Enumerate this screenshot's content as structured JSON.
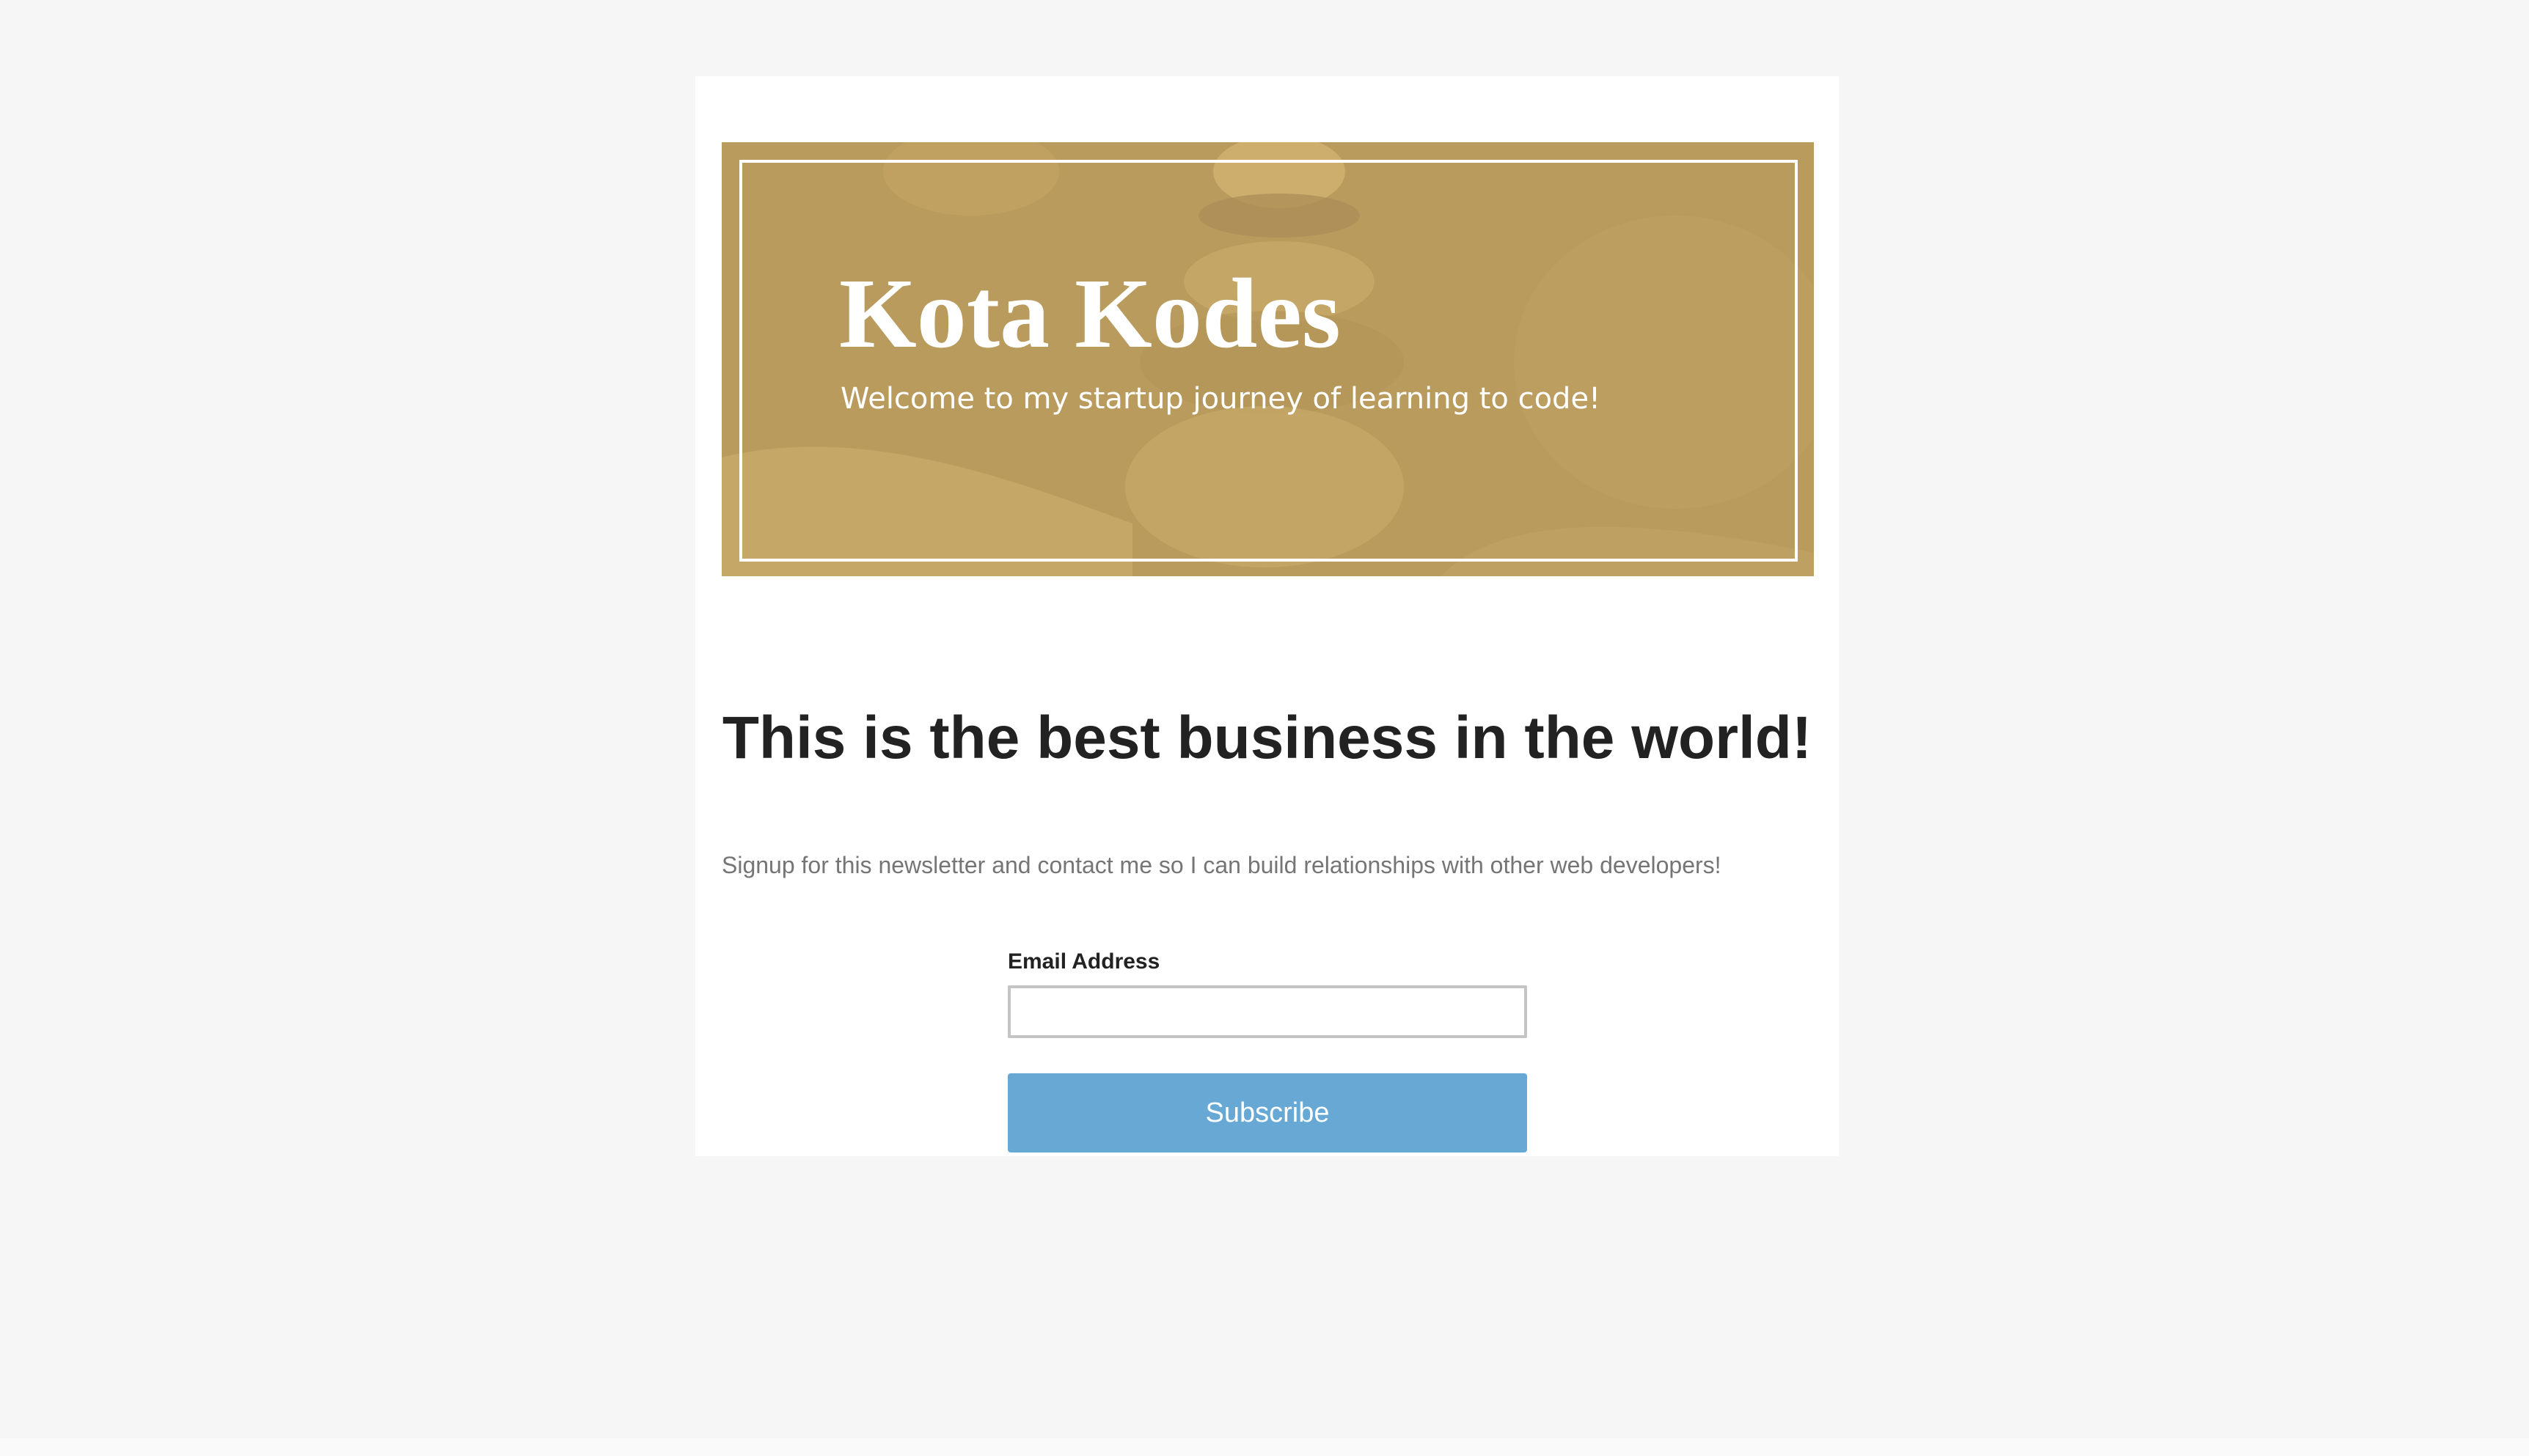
{
  "hero": {
    "title": "Kota Kodes",
    "subtitle": "Welcome to my startup journey of learning to code!",
    "background_color": "#b99b5e",
    "image_description": "stacked-stones-photo"
  },
  "main": {
    "headline": "This is the best business in the world!",
    "intro": "Signup for this newsletter and contact me so I can build relationships with other web developers!"
  },
  "form": {
    "email_label": "Email Address",
    "email_value": "",
    "email_placeholder": "",
    "subscribe_label": "Subscribe",
    "button_color": "#67a9d4"
  },
  "colors": {
    "page_background": "#f6f6f6",
    "card_background": "#ffffff",
    "heading_text": "#222222",
    "body_text": "#757575"
  }
}
